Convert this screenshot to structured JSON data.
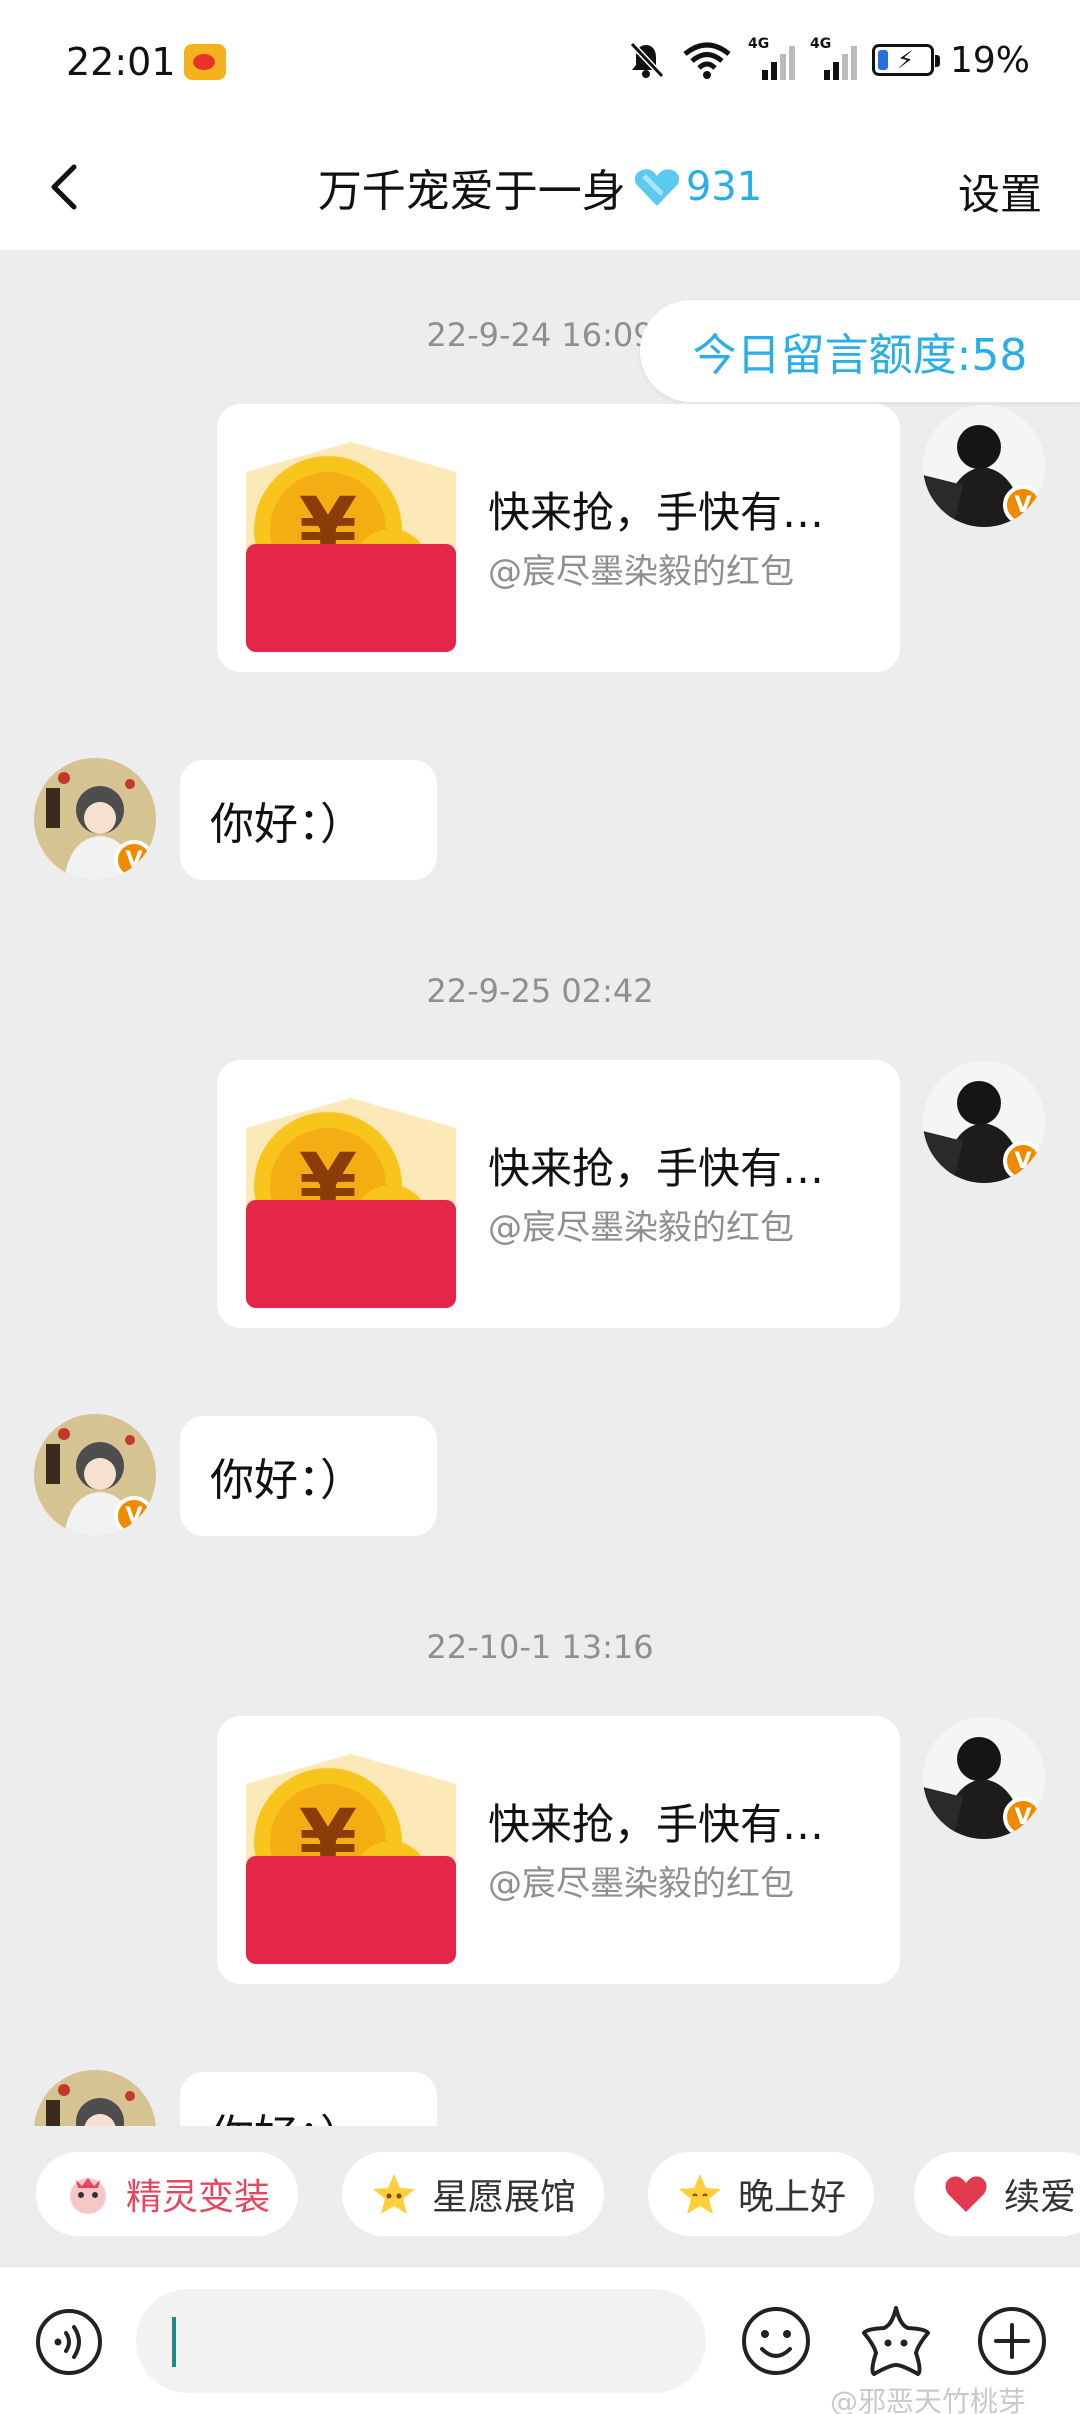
{
  "status_bar": {
    "time": "22:01",
    "battery_pct": "19%",
    "network_1": "4G",
    "network_2": "4G",
    "battery_level": 0.19
  },
  "nav": {
    "title": "万千宠爱于一身",
    "badge_count": "931",
    "settings": "设置"
  },
  "quota": {
    "label": "今日留言额度:58"
  },
  "messages": [
    {
      "timestamp": "22-9-24 16:09",
      "red_packet": {
        "title": "快来抢，手快有…",
        "subtitle": "@宸尽墨染毅的红包"
      },
      "reply": "你好：）"
    },
    {
      "timestamp": "22-9-25 02:42",
      "red_packet": {
        "title": "快来抢，手快有…",
        "subtitle": "@宸尽墨染毅的红包"
      },
      "reply": "你好：）"
    },
    {
      "timestamp": "22-10-1 13:16",
      "red_packet": {
        "title": "快来抢，手快有…",
        "subtitle": "@宸尽墨染毅的红包"
      },
      "reply": "你好：）"
    }
  ],
  "verified_mark": "V",
  "quick_replies": [
    {
      "label": "精灵变装",
      "icon": "sprite-icon",
      "color": "#e5475e"
    },
    {
      "label": "星愿展馆",
      "icon": "star-icon",
      "color": "#333333"
    },
    {
      "label": "晚上好",
      "icon": "star-face-icon",
      "color": "#333333"
    },
    {
      "label": "续爱",
      "icon": "heart-icon",
      "color": "#333333"
    }
  ],
  "watermark": "@邪恶天竹桃芽",
  "colors": {
    "accent": "#2aaee9",
    "red_packet": "#e3264a",
    "coin": "#f8c51c",
    "verified": "#f08a00"
  }
}
